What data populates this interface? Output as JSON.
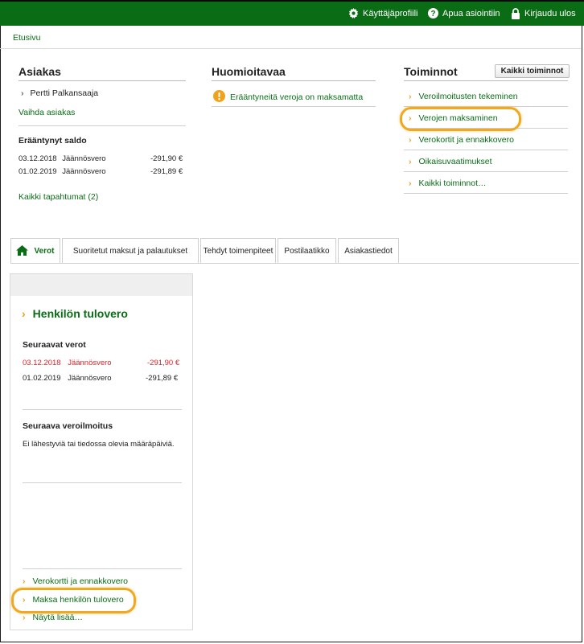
{
  "topbar": {
    "profile": "Käyttäjäprofiili",
    "help": "Apua asiointiin",
    "logout": "Kirjaudu ulos"
  },
  "nav": {
    "home": "Etusivu"
  },
  "customer": {
    "title": "Asiakas",
    "name": "Pertti Palkansaaja",
    "change": "Vaihda asiakas",
    "overdue_title": "Erääntynyt saldo",
    "overdue": [
      {
        "date": "03.12.2018",
        "type": "Jäännösvero",
        "amount": "-291,90 €"
      },
      {
        "date": "01.02.2019",
        "type": "Jäännösvero",
        "amount": "-291,89 €"
      }
    ],
    "all_events": "Kaikki tapahtumat (2)"
  },
  "notices": {
    "title": "Huomioitavaa",
    "item": "Erääntyneitä veroja on maksamatta"
  },
  "actions": {
    "title": "Toiminnot",
    "all_button": "Kaikki toiminnot",
    "items": [
      "Veroilmoitusten tekeminen",
      "Verojen maksaminen",
      "Verokortit ja ennakkovero",
      "Oikaisuvaatimukset",
      "Kaikki toiminnot…"
    ]
  },
  "tabs": [
    "Verot",
    "Suoritetut maksut ja palautukset",
    "Tehdyt toimenpiteet",
    "Postilaatikko",
    "Asiakastiedot"
  ],
  "panel": {
    "title": "Henkilön tulovero",
    "next_taxes_title": "Seuraavat verot",
    "next_taxes": [
      {
        "date": "03.12.2018",
        "type": "Jäännösvero",
        "amount": "-291,90 €"
      },
      {
        "date": "01.02.2019",
        "type": "Jäännösvero",
        "amount": "-291,89 €"
      }
    ],
    "next_return_title": "Seuraava veroilmoitus",
    "next_return_text": "Ei lähestyviä tai tiedossa olevia määräpäiviä.",
    "links": [
      "Verokortti ja ennakkovero",
      "Maksa henkilön tulovero",
      "Näytä lisää…"
    ]
  },
  "colors": {
    "brand_green": "#0a6d16",
    "highlight": "#f1a81f",
    "chevron": "#e8a420",
    "overdue_red": "#e0212a"
  }
}
